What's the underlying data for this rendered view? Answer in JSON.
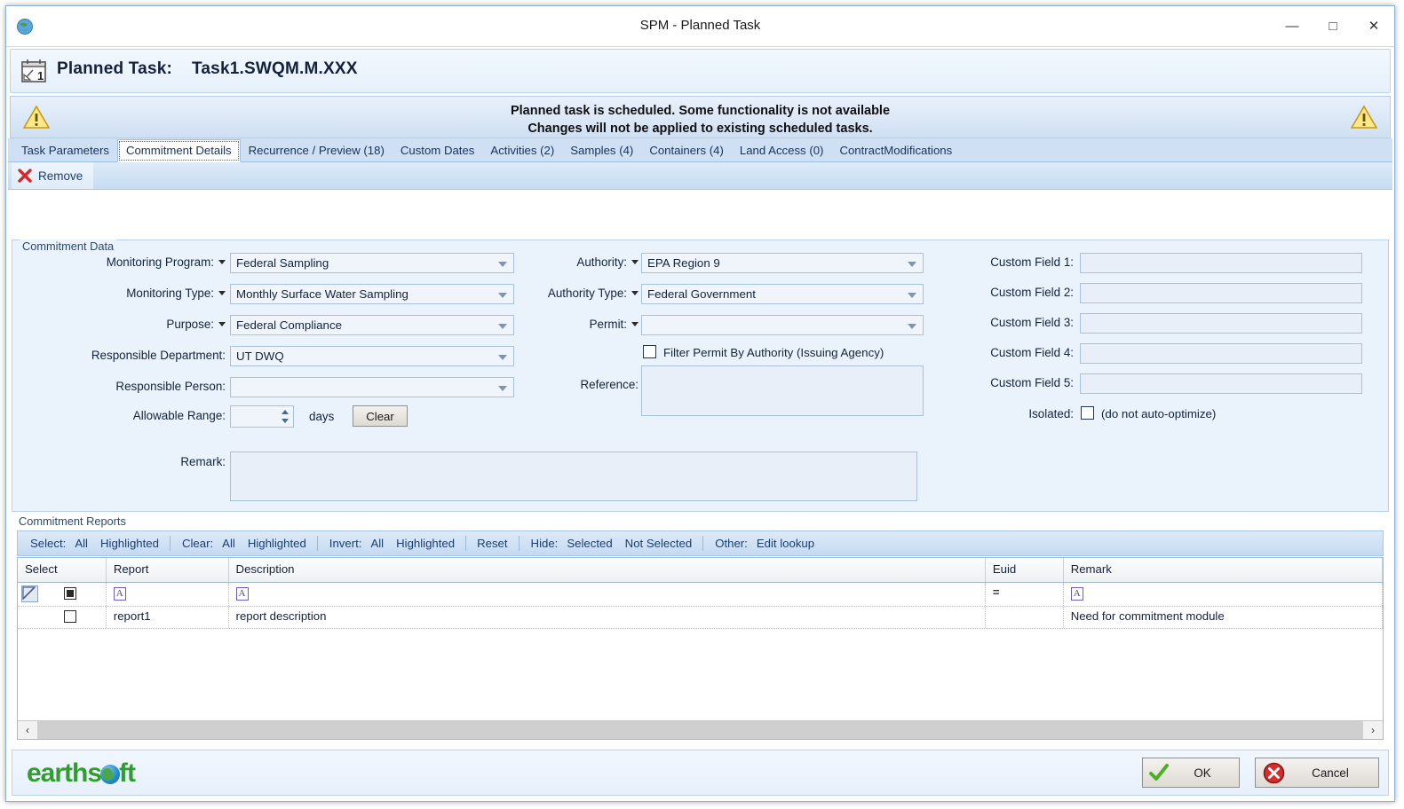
{
  "window": {
    "title": "SPM - Planned Task",
    "icon": "app-globe-icon",
    "minimize": "—",
    "maximize": "□",
    "close": "✕"
  },
  "header": {
    "label": "Planned Task:",
    "task_id": "Task1.SWQM.M.XXX",
    "icon": "calendar-task-icon"
  },
  "warning": {
    "line1": "Planned task is scheduled. Some functionality is not available",
    "line2": "Changes will not be applied to existing scheduled tasks.",
    "icon": "warning-triangle-icon"
  },
  "tabs": [
    {
      "label": "Task Parameters",
      "selected": false
    },
    {
      "label": "Commitment Details",
      "selected": true
    },
    {
      "label": "Recurrence / Preview (18)",
      "selected": false
    },
    {
      "label": "Custom Dates",
      "selected": false
    },
    {
      "label": "Activities (2)",
      "selected": false
    },
    {
      "label": "Samples (4)",
      "selected": false
    },
    {
      "label": "Containers (4)",
      "selected": false
    },
    {
      "label": "Land Access (0)",
      "selected": false
    },
    {
      "label": "ContractModifications",
      "selected": false
    }
  ],
  "toolbar": {
    "remove_label": "Remove",
    "remove_icon": "red-x-icon"
  },
  "commitment_data": {
    "caption": "Commitment Data",
    "left_fields": [
      {
        "label": "Monitoring Program:",
        "value": "Federal Sampling",
        "dropdown_caret": true
      },
      {
        "label": "Monitoring Type:",
        "value": "Monthly Surface Water Sampling",
        "dropdown_caret": true
      },
      {
        "label": "Purpose:",
        "value": "Federal Compliance",
        "dropdown_caret": true
      },
      {
        "label": "Responsible Department:",
        "value": "UT DWQ",
        "dropdown_caret": false
      },
      {
        "label": "Responsible Person:",
        "value": "",
        "dropdown_caret": false
      }
    ],
    "allowable_range": {
      "label": "Allowable Range:",
      "value": "",
      "units": "days",
      "clear_button": "Clear"
    },
    "remark": {
      "label": "Remark:",
      "value": ""
    },
    "middle_fields": [
      {
        "label": "Authority:",
        "value": "EPA Region 9",
        "dropdown_caret": true
      },
      {
        "label": "Authority Type:",
        "value": "Federal Government",
        "dropdown_caret": true
      },
      {
        "label": "Permit:",
        "value": "",
        "dropdown_caret": true
      }
    ],
    "filter_permit": {
      "label": "Filter Permit By Authority (Issuing Agency)",
      "checked": false
    },
    "reference": {
      "label": "Reference:",
      "value": ""
    },
    "custom_fields": [
      {
        "label": "Custom Field 1:",
        "value": ""
      },
      {
        "label": "Custom Field 2:",
        "value": ""
      },
      {
        "label": "Custom Field 3:",
        "value": ""
      },
      {
        "label": "Custom Field 4:",
        "value": ""
      },
      {
        "label": "Custom Field 5:",
        "value": ""
      }
    ],
    "isolated": {
      "label": "Isolated:",
      "note": "(do not auto-optimize)",
      "checked": false
    }
  },
  "commitment_reports": {
    "caption": "Commitment Reports",
    "toolbar": {
      "select_key": "Select:",
      "select_all": "All",
      "select_highlighted": "Highlighted",
      "clear_key": "Clear:",
      "clear_all": "All",
      "clear_highlighted": "Highlighted",
      "invert_key": "Invert:",
      "invert_all": "All",
      "invert_highlighted": "Highlighted",
      "reset": "Reset",
      "hide_key": "Hide:",
      "hide_selected": "Selected",
      "hide_not_selected": "Not Selected",
      "other_key": "Other:",
      "other_edit_lookup": "Edit lookup"
    },
    "columns": [
      "Select",
      "Report",
      "Description",
      "Euid",
      "Remark"
    ],
    "filter_row": {
      "select": "filter-indicator-icon",
      "select_checkbox": "filled",
      "report": "A",
      "description": "A",
      "euid": "=",
      "remark": "A"
    },
    "rows": [
      {
        "select_checked": false,
        "report": "report1",
        "description": "report description",
        "euid": "",
        "remark": "Need for commitment module"
      }
    ]
  },
  "footer": {
    "logo_part1": "earths",
    "logo_part2": "ft",
    "ok_label": "OK",
    "cancel_label": "Cancel",
    "ok_icon": "green-check-icon",
    "cancel_icon": "red-x-circle-icon"
  },
  "scrollbar": {
    "left_arrow": "‹",
    "right_arrow": "›"
  }
}
